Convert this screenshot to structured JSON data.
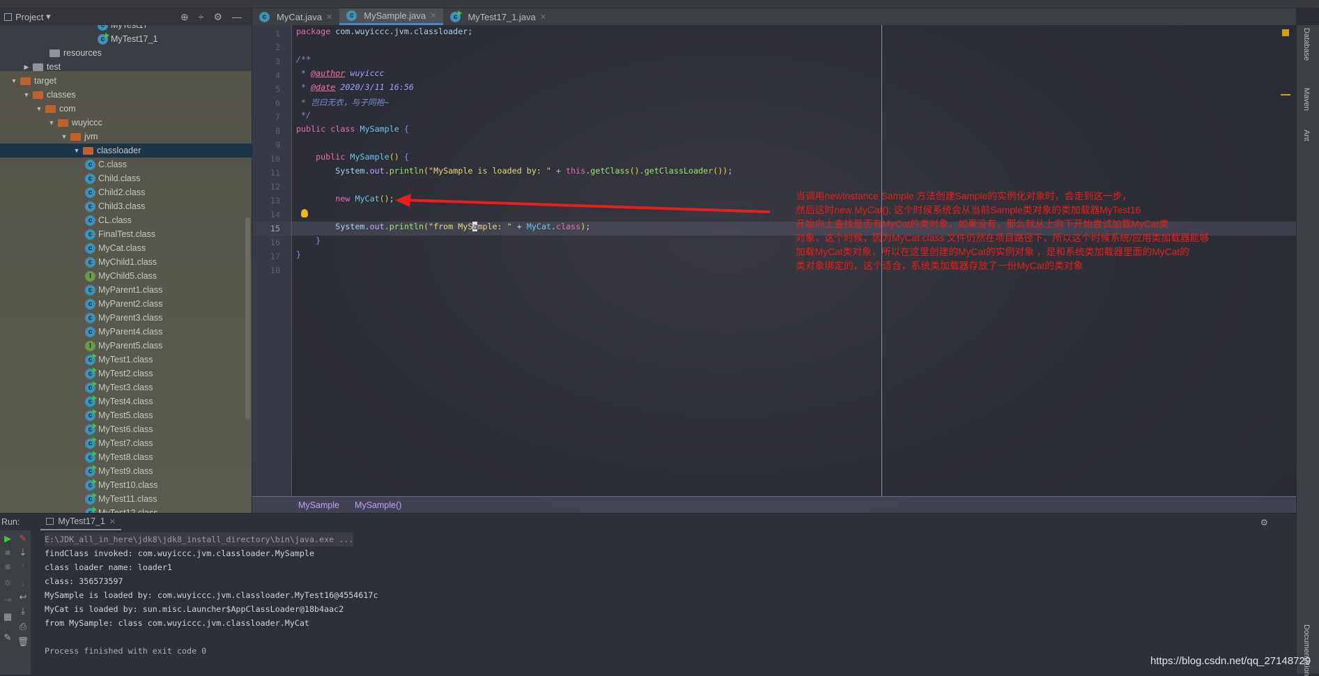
{
  "sidebar": {
    "title": "Project",
    "dropdown": "▾",
    "tools": [
      "⊕",
      "÷",
      "⚙",
      "—"
    ],
    "tree": [
      {
        "label": "MyTest17",
        "lvl": 7,
        "kind": "run"
      },
      {
        "label": "MyTest17_1",
        "lvl": 7,
        "kind": "run"
      },
      {
        "label": "resources",
        "lvl": 3,
        "kind": "grey"
      },
      {
        "label": "test",
        "lvl": 1,
        "kind": "grey",
        "arrow": "▶"
      },
      {
        "label": "target",
        "lvl": 0,
        "kind": "folder",
        "arrow": "▼"
      },
      {
        "label": "classes",
        "lvl": 1,
        "kind": "folder",
        "arrow": "▼"
      },
      {
        "label": "com",
        "lvl": 2,
        "kind": "folder",
        "arrow": "▼"
      },
      {
        "label": "wuyiccc",
        "lvl": 3,
        "kind": "folder",
        "arrow": "▼"
      },
      {
        "label": "jvm",
        "lvl": 4,
        "kind": "folder",
        "arrow": "▼"
      },
      {
        "label": "classloader",
        "lvl": 5,
        "kind": "folder",
        "arrow": "▼",
        "selected": true
      },
      {
        "label": "C.class",
        "lvl": 6,
        "kind": "c"
      },
      {
        "label": "Child.class",
        "lvl": 6,
        "kind": "c"
      },
      {
        "label": "Child2.class",
        "lvl": 6,
        "kind": "c"
      },
      {
        "label": "Child3.class",
        "lvl": 6,
        "kind": "c"
      },
      {
        "label": "CL.class",
        "lvl": 6,
        "kind": "c"
      },
      {
        "label": "FinalTest.class",
        "lvl": 6,
        "kind": "c"
      },
      {
        "label": "MyCat.class",
        "lvl": 6,
        "kind": "c"
      },
      {
        "label": "MyChild1.class",
        "lvl": 6,
        "kind": "c"
      },
      {
        "label": "MyChild5.class",
        "lvl": 6,
        "kind": "i"
      },
      {
        "label": "MyParent1.class",
        "lvl": 6,
        "kind": "c"
      },
      {
        "label": "MyParent2.class",
        "lvl": 6,
        "kind": "c"
      },
      {
        "label": "MyParent3.class",
        "lvl": 6,
        "kind": "c"
      },
      {
        "label": "MyParent4.class",
        "lvl": 6,
        "kind": "c"
      },
      {
        "label": "MyParent5.class",
        "lvl": 6,
        "kind": "i"
      },
      {
        "label": "MyTest1.class",
        "lvl": 6,
        "kind": "run"
      },
      {
        "label": "MyTest2.class",
        "lvl": 6,
        "kind": "run"
      },
      {
        "label": "MyTest3.class",
        "lvl": 6,
        "kind": "run"
      },
      {
        "label": "MyTest4.class",
        "lvl": 6,
        "kind": "run"
      },
      {
        "label": "MyTest5.class",
        "lvl": 6,
        "kind": "run"
      },
      {
        "label": "MyTest6.class",
        "lvl": 6,
        "kind": "run"
      },
      {
        "label": "MyTest7.class",
        "lvl": 6,
        "kind": "run"
      },
      {
        "label": "MyTest8.class",
        "lvl": 6,
        "kind": "run"
      },
      {
        "label": "MyTest9.class",
        "lvl": 6,
        "kind": "run"
      },
      {
        "label": "MyTest10.class",
        "lvl": 6,
        "kind": "run"
      },
      {
        "label": "MyTest11.class",
        "lvl": 6,
        "kind": "run"
      },
      {
        "label": "MyTest12.class",
        "lvl": 6,
        "kind": "run"
      }
    ]
  },
  "tabs": [
    {
      "label": "MyCat.java",
      "active": false
    },
    {
      "label": "MySample.java",
      "active": true
    },
    {
      "label": "MyTest17_1.java",
      "active": false
    }
  ],
  "editor": {
    "current_line": 15,
    "lines": [
      [
        [
          "package ",
          "kw"
        ],
        [
          "com.wuyiccc.jvm.classloader;",
          "id"
        ]
      ],
      [],
      [
        [
          "/**",
          "doc"
        ]
      ],
      [
        [
          " * ",
          "doc"
        ],
        [
          "@author",
          "tag"
        ],
        [
          " wuyiccc",
          "docv"
        ]
      ],
      [
        [
          " * ",
          "doc"
        ],
        [
          "@date",
          "tag"
        ],
        [
          " 2020/3/11 16:56",
          "docv"
        ]
      ],
      [
        [
          " * 岂曰无衣，与子同袍~",
          "doc"
        ]
      ],
      [
        [
          " */",
          "doc"
        ]
      ],
      [
        [
          "public class ",
          "kw"
        ],
        [
          "MySample ",
          "cls"
        ],
        [
          "{",
          "br"
        ]
      ],
      [],
      [
        [
          "    public ",
          "kw"
        ],
        [
          "MySample",
          "cls"
        ],
        [
          "() ",
          "par"
        ],
        [
          "{",
          "br"
        ]
      ],
      [
        [
          "        System.",
          "id"
        ],
        [
          "out",
          "fld"
        ],
        [
          ".",
          "id"
        ],
        [
          "println",
          "mth"
        ],
        [
          "(",
          "par"
        ],
        [
          "\"MySample is loaded by: \"",
          "str"
        ],
        [
          " + ",
          "pun"
        ],
        [
          "this",
          "kw"
        ],
        [
          ".",
          "id"
        ],
        [
          "getClass",
          "mth"
        ],
        [
          "()",
          "par"
        ],
        [
          ".",
          "id"
        ],
        [
          "getClassLoader",
          "mth"
        ],
        [
          "())",
          "par"
        ],
        [
          ";",
          "pun"
        ]
      ],
      [],
      [
        [
          "        new ",
          "kw"
        ],
        [
          "MyCat",
          "cls"
        ],
        [
          "()",
          "par"
        ],
        [
          ";",
          "pun"
        ]
      ],
      [],
      [
        [
          "        System.",
          "id"
        ],
        [
          "out",
          "fld"
        ],
        [
          ".",
          "id"
        ],
        [
          "println",
          "mth"
        ],
        [
          "(",
          "par"
        ],
        [
          "\"from MyS",
          "str"
        ],
        [
          "a",
          "caret"
        ],
        [
          "mple: \"",
          "str"
        ],
        [
          " + ",
          "pun"
        ],
        [
          "MyCat",
          "cls"
        ],
        [
          ".",
          "id"
        ],
        [
          "class",
          "kw"
        ],
        [
          ")",
          "par"
        ],
        [
          ";",
          "pun"
        ]
      ],
      [
        [
          "    }",
          "br"
        ]
      ],
      [
        [
          "}",
          "br"
        ]
      ],
      []
    ]
  },
  "annotation": [
    "当调用newInstance Sample 方法创建Sample的实例化对象时，会走到这一步，",
    "然后这时new MyCat(); 这个时候系统会从当前Sample类对象的类加载器MyTest16",
    "开始向上查找是否有MyCat的类对象，如果没有，那么就从上向下开始尝试加载MyCat类",
    "对象，这个时候，因为MyCat.class 文件仍然在项目路径下，所以这个时候系统/应用类加载器能够",
    "加载MyCat类对象，所以在这里创建的MyCat的实例对象 ，是和系统类加载器里面的MyCat的",
    "类对象绑定的，这个适合，系统类加载器存放了一份MyCat的类对象"
  ],
  "annotation_color": "#e8201c",
  "breadcrumb": [
    "MySample",
    "MySample()"
  ],
  "right_strip": [
    "Database",
    "Maven",
    "Ant",
    "Documentation"
  ],
  "run": {
    "label": "Run:",
    "tab": "MyTest17_1",
    "output": [
      {
        "text": "E:\\JDK_all_in_here\\jdk8\\jdk8_install_directory\\bin\\java.exe ...",
        "kind": "cmd"
      },
      {
        "text": "findClass invoked: com.wuyiccc.jvm.classloader.MySample"
      },
      {
        "text": "class loader name: loader1"
      },
      {
        "text": "class: 356573597"
      },
      {
        "text": "MySample is loaded by: com.wuyiccc.jvm.classloader.MyTest16@4554617c"
      },
      {
        "text": "MyCat is loaded by: sun.misc.Launcher$AppClassLoader@18b4aac2"
      },
      {
        "text": "from MySample: class com.wuyiccc.jvm.classloader.MyCat"
      },
      {
        "text": ""
      },
      {
        "text": "Process finished with exit code 0",
        "kind": "dim"
      }
    ]
  },
  "watermark": "https://blog.csdn.net/qq_27148729"
}
